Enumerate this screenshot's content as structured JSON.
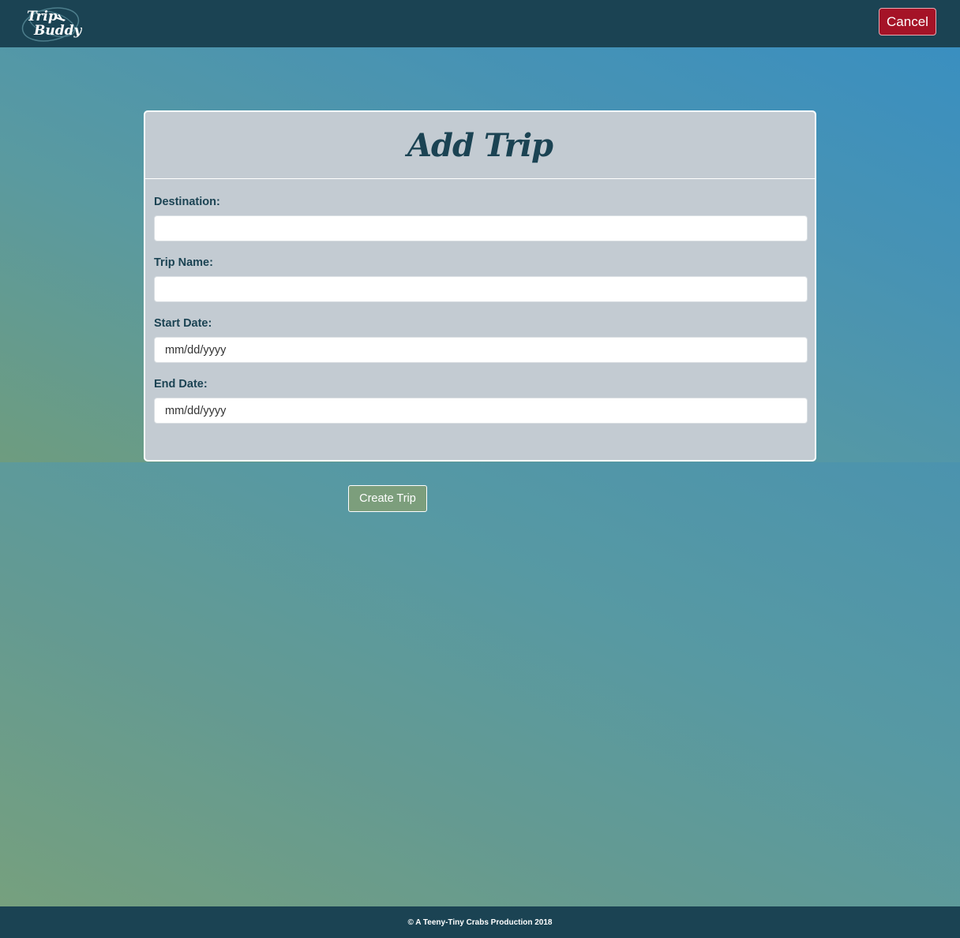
{
  "header": {
    "logo": {
      "line1": "Trip",
      "line2": "Buddy",
      "icon": "airplane-icon"
    },
    "cancel_label": "Cancel"
  },
  "form": {
    "title": "Add Trip",
    "fields": [
      {
        "label": "Destination:",
        "value": "",
        "placeholder": ""
      },
      {
        "label": "Trip Name:",
        "value": "",
        "placeholder": ""
      },
      {
        "label": "Start Date:",
        "value": "",
        "placeholder": "mm/dd/yyyy"
      },
      {
        "label": "End Date:",
        "value": "",
        "placeholder": "mm/dd/yyyy"
      }
    ],
    "submit_label": "Create Trip"
  },
  "footer": {
    "text": "© A Teeny-Tiny Crabs Production 2018"
  },
  "colors": {
    "nav": "#1b4353",
    "cancel": "#a51327",
    "card": "#c3cbd2",
    "create": "#7c9e7c",
    "heading": "#1b4353"
  }
}
